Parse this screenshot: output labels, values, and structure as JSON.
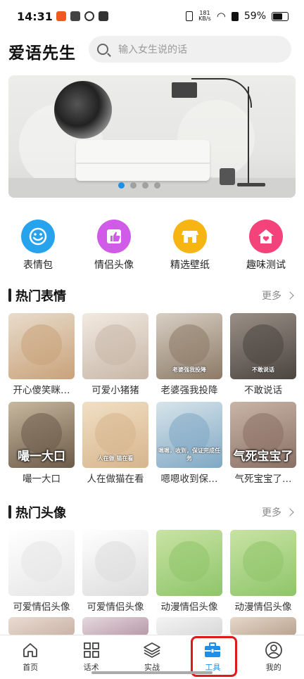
{
  "status": {
    "time": "14:31",
    "speed_value": "181",
    "speed_unit": "KB/s",
    "battery": "59%"
  },
  "header": {
    "app_title": "爱语先生",
    "search_placeholder": "输入女生说的话"
  },
  "banner": {
    "dot_count": 4,
    "active_dot": 1
  },
  "categories": [
    {
      "label": "表情包",
      "icon": "smiley-icon",
      "color": "#27a3ee"
    },
    {
      "label": "情侣头像",
      "icon": "thumbs-up-icon",
      "color": "#d05be6"
    },
    {
      "label": "精选壁纸",
      "icon": "store-icon",
      "color": "#f7b514"
    },
    {
      "label": "趣味测试",
      "icon": "house-heart-icon",
      "color": "#f4427a"
    }
  ],
  "hot_emoji": {
    "title": "热门表情",
    "more": "更多",
    "items": [
      {
        "name": "开心傻笑眯…",
        "caption": "",
        "colors": [
          "#c9a27a",
          "#e8dccc"
        ]
      },
      {
        "name": "可爱小猪猪",
        "caption": "",
        "colors": [
          "#c7b7a8",
          "#f2e9e0"
        ]
      },
      {
        "name": "老婆强我投降",
        "caption": "老婆强我投降",
        "colors": [
          "#8c7a66",
          "#d8cfc4"
        ]
      },
      {
        "name": "不敢说话",
        "caption": "不敢说话",
        "colors": [
          "#4b4540",
          "#9a8f86"
        ]
      },
      {
        "name": "嘬一大口",
        "caption": "嘬一大口",
        "colors": [
          "#6a5a48",
          "#c8b89f"
        ]
      },
      {
        "name": "人在做猫在看",
        "caption": "人在做 猫在看",
        "colors": [
          "#d6b58d",
          "#f1dfc4"
        ]
      },
      {
        "name": "嗯嗯收到保…",
        "caption": "嗯嗯，收到，保证完成任务",
        "colors": [
          "#7fa8c4",
          "#d8e4ea"
        ]
      },
      {
        "name": "气死宝宝了…",
        "caption": "气死宝宝了",
        "colors": [
          "#8a7064",
          "#c9b4a8"
        ]
      }
    ]
  },
  "hot_avatar": {
    "title": "热门头像",
    "more": "更多",
    "items": [
      {
        "name": "可爱情侣头像",
        "caption": "",
        "colors": [
          "#e6e6e6",
          "#ffffff"
        ]
      },
      {
        "name": "可爱情侣头像",
        "caption": "",
        "colors": [
          "#dcdcdc",
          "#ffffff"
        ]
      },
      {
        "name": "动漫情侣头像",
        "caption": "",
        "colors": [
          "#8fc56a",
          "#c8e3a3"
        ]
      },
      {
        "name": "动漫情侣头像",
        "caption": "",
        "colors": [
          "#8fc56a",
          "#c8e3a3"
        ]
      }
    ],
    "partial_row_colors": [
      [
        "#c9b3a6",
        "#eadcd2"
      ],
      [
        "#b79aa8",
        "#e6d8de"
      ],
      [
        "#d8d8d8",
        "#f4f4f4"
      ],
      [
        "#b9a38f",
        "#e6d8cb"
      ]
    ]
  },
  "tabbar": {
    "tabs": [
      {
        "label": "首页",
        "icon": "home-icon"
      },
      {
        "label": "话术",
        "icon": "grid-icon"
      },
      {
        "label": "实战",
        "icon": "layers-icon"
      },
      {
        "label": "工具",
        "icon": "toolbox-icon"
      },
      {
        "label": "我的",
        "icon": "user-icon"
      }
    ],
    "active_index": 3
  },
  "accent_color": "#1e8fe8",
  "highlight_color": "#e01a1a"
}
